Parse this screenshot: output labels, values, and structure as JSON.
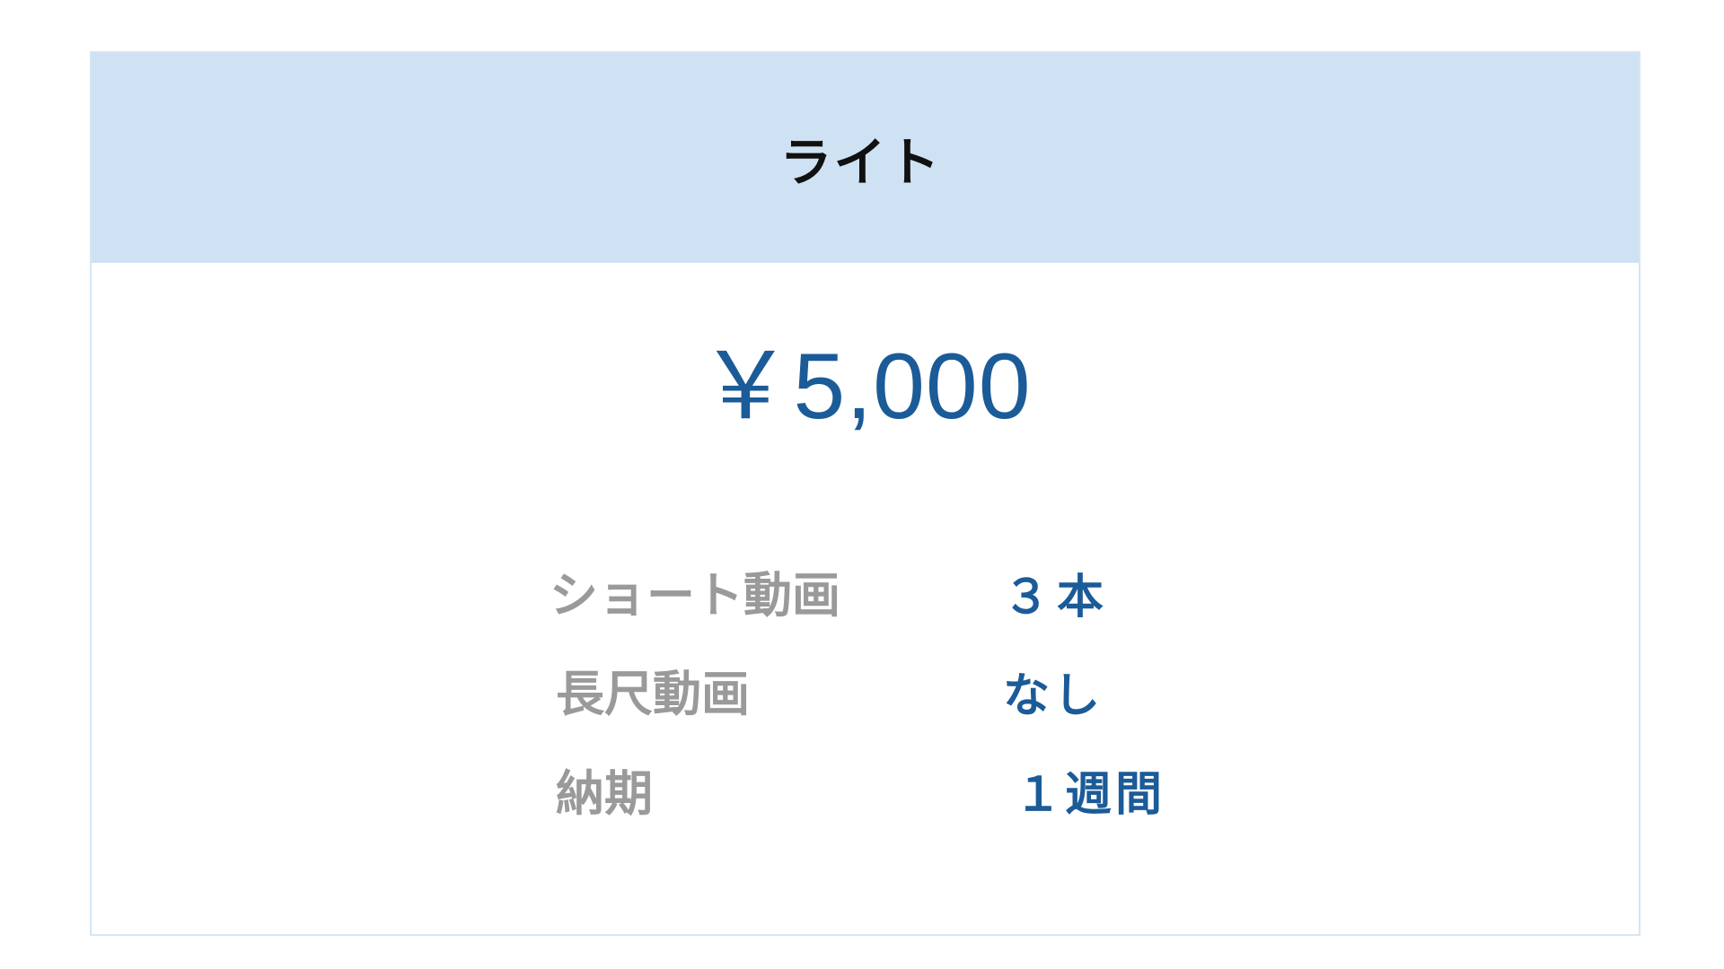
{
  "plan": {
    "title": "ライト",
    "price": "￥5,000",
    "features": [
      {
        "label": "ショート動画",
        "value": "３本"
      },
      {
        "label": "長尺動画",
        "value": "なし"
      },
      {
        "label": "納期",
        "value": "１週間"
      }
    ]
  },
  "colors": {
    "header_background": "#cfe2f3",
    "accent": "#1b5b98",
    "label_text": "#9a9a9a",
    "title_text": "#111111",
    "border": "#d6e6f3"
  }
}
